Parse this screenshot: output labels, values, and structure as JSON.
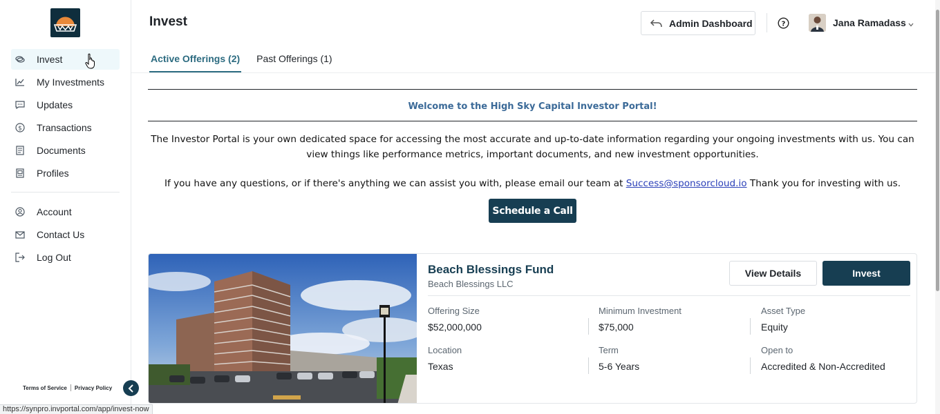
{
  "sidebar": {
    "items": [
      {
        "label": "Invest",
        "icon": "coins-icon"
      },
      {
        "label": "My Investments",
        "icon": "chart-line-icon"
      },
      {
        "label": "Updates",
        "icon": "message-icon"
      },
      {
        "label": "Transactions",
        "icon": "dollar-circle-icon"
      },
      {
        "label": "Documents",
        "icon": "document-icon"
      },
      {
        "label": "Profiles",
        "icon": "profile-card-icon"
      }
    ],
    "secondary_items": [
      {
        "label": "Account",
        "icon": "user-circle-icon"
      },
      {
        "label": "Contact Us",
        "icon": "mail-icon"
      },
      {
        "label": "Log Out",
        "icon": "logout-icon"
      }
    ],
    "footer": {
      "terms": "Terms of Service",
      "privacy": "Privacy Policy"
    }
  },
  "header": {
    "title": "Invest",
    "admin_button": "Admin Dashboard",
    "user_name": "Jana Ramadass"
  },
  "tabs": [
    {
      "label": "Active Offerings (2)"
    },
    {
      "label": "Past Offerings (1)"
    }
  ],
  "welcome": {
    "title": "Welcome to the High Sky Capital Investor Portal!",
    "body": "The Investor Portal is your own dedicated space for accessing the most accurate and up-to-date information regarding your ongoing investments with us. You can view things like performance metrics, important documents, and new investment opportunities.",
    "contact_prefix": "If you have any questions, or if there's anything we can assist you with, please email our team at ",
    "contact_email": "Success@sponsorcloud.io",
    "contact_suffix": " Thank you for investing with us.",
    "schedule_button": "Schedule a Call"
  },
  "offering": {
    "name": "Beach Blessings Fund",
    "sponsor": "Beach Blessings LLC",
    "view_button": "View Details",
    "invest_button": "Invest",
    "fields": [
      {
        "label": "Offering Size",
        "value": "$52,000,000"
      },
      {
        "label": "Minimum Investment",
        "value": "$75,000"
      },
      {
        "label": "Asset Type",
        "value": "Equity"
      },
      {
        "label": "Location",
        "value": "Texas"
      },
      {
        "label": "Term",
        "value": "5-6 Years"
      },
      {
        "label": "Open to",
        "value": "Accredited & Non-Accredited"
      }
    ]
  },
  "status_bar": {
    "url": "https://synpro.invportal.com/app/invest-now"
  },
  "colors": {
    "primary": "#173e52",
    "tab_active": "#2c6b80",
    "welcome_title": "#3b6a98",
    "link": "#2a3fb8"
  }
}
